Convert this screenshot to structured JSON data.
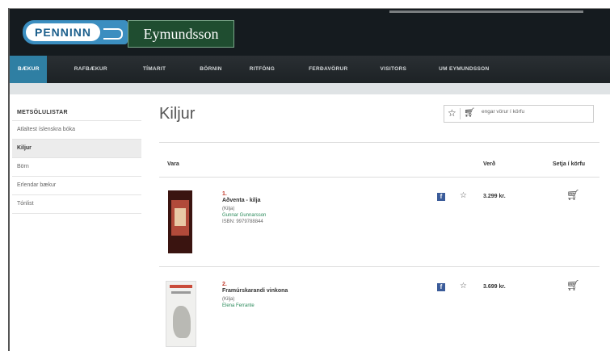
{
  "header": {
    "logo_left": "PENNINN",
    "logo_right": "Eymundsson"
  },
  "nav": [
    {
      "label": "BÆKUR",
      "active": true
    },
    {
      "label": "RAFBÆKUR"
    },
    {
      "label": "TÍMARIT"
    },
    {
      "label": "BÖRNIN"
    },
    {
      "label": "RITFÖNG"
    },
    {
      "label": "FERÐAVÖRUR"
    },
    {
      "label": "VISITORS"
    },
    {
      "label": "UM EYMUNDSSON"
    }
  ],
  "sidebar": {
    "title": "METSÖLULISTAR",
    "items": [
      {
        "label": "Atlaltest íslenskra bóka"
      },
      {
        "label": "Kiljur",
        "active": true
      },
      {
        "label": "Börn"
      },
      {
        "label": "Erlendar bækur"
      },
      {
        "label": "Tónlist"
      }
    ]
  },
  "main": {
    "title": "Kiljur",
    "search_placeholder": "engar vörur í körfu",
    "columns": {
      "item": "Vara",
      "price": "Verð",
      "cart": "Setja í körfu"
    },
    "books": [
      {
        "rank": "1.",
        "title": "Aðventa - kilja",
        "format": "(Kilja)",
        "author": "Gunnar Gunnarsson",
        "isbn": "ISBN: 9979788844",
        "price": "3.299 kr."
      },
      {
        "rank": "2.",
        "title": "Framúrskarandi vinkona",
        "format": "(Kilja)",
        "author": "Elena Ferrante",
        "isbn": "",
        "price": "3.699 kr."
      }
    ]
  },
  "icons": {
    "facebook": "facebook-icon",
    "wishlist": "star-icon",
    "cart": "cart-icon"
  }
}
